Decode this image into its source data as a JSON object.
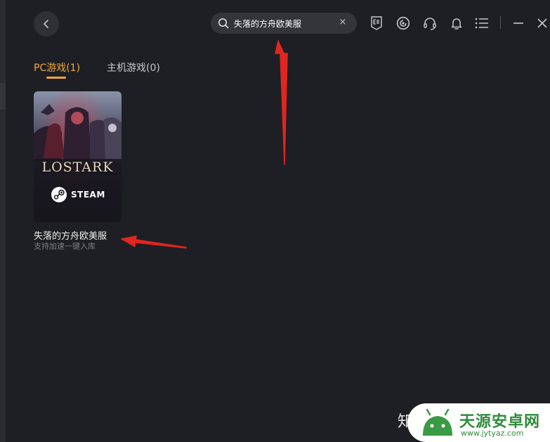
{
  "header": {
    "search": {
      "value": "失落的方舟欧美服",
      "clear_label": "×"
    },
    "icons": [
      "epic-games-icon",
      "ubisoft-icon",
      "headset-support-icon",
      "bell-notification-icon",
      "menu-list-icon",
      "minimize-icon",
      "close-icon"
    ]
  },
  "tabs": [
    {
      "label": "PC游戏(1)",
      "active": true
    },
    {
      "label": "主机游戏(0)",
      "active": false
    }
  ],
  "results": [
    {
      "cover_logo": "LOSTARK",
      "platform": "STEAM",
      "title": "失落的方舟欧美服",
      "subtitle": "支持加速一键入库"
    }
  ],
  "watermark": {
    "prefix": "知",
    "site_name": "天源安卓网",
    "url": "www.jytyaz.com"
  },
  "colors": {
    "background": "#1e1f24",
    "accent": "#f5a73b",
    "annotation_arrow": "#e0261f"
  }
}
